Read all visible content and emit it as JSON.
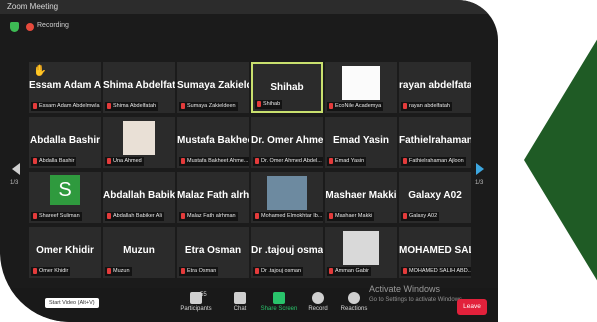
{
  "window": {
    "title": "Zoom Meeting",
    "recording_label": "Recording"
  },
  "pages": {
    "left": "1/3",
    "right": "1/3"
  },
  "tiles": [
    {
      "name": "Essam Adam Ab...",
      "label": "Essam Adam Abdelmwla",
      "hand": "✋"
    },
    {
      "name": "Shima Abdelfatah",
      "label": "Shima Abdelfatah"
    },
    {
      "name": "Sumaya Zakield...",
      "label": "Sumaya Zakieldeen"
    },
    {
      "name": "Shihab",
      "label": "Shihab"
    },
    {
      "name": "",
      "label": "EcoNile Academya"
    },
    {
      "name": "rayan abdelfatah",
      "label": "rayan abdelfatah"
    },
    {
      "name": "Abdalla Bashir",
      "label": "Abdalla Bashir"
    },
    {
      "name": "",
      "label": "Una Ahmed"
    },
    {
      "name": "Mustafa Bakhee...",
      "label": "Mustafa Bakheet Ahme..."
    },
    {
      "name": "Dr. Omer Ahme...",
      "label": "Dr. Omer Ahmed Abdel..."
    },
    {
      "name": "Emad Yasin",
      "label": "Emad Yasin"
    },
    {
      "name": "Fathielrahaman...",
      "label": "Fathielrahaman Ajloon"
    },
    {
      "name": "",
      "label": "Shareef Suliman",
      "avatar_letter": "S"
    },
    {
      "name": "Abdallah Babike...",
      "label": "Abdallah Babiker Ali"
    },
    {
      "name": "Malaz Fath alrh...",
      "label": "Malaz Fath alrhman"
    },
    {
      "name": "",
      "label": "Mohamed Elmokhtar Ib..."
    },
    {
      "name": "Mashaer Makki",
      "label": "Mashaer Makki"
    },
    {
      "name": "Galaxy A02",
      "label": "Galaxy A02"
    },
    {
      "name": "Omer Khidir",
      "label": "Omer Khidir"
    },
    {
      "name": "Muzun",
      "label": "Muzun"
    },
    {
      "name": "Etra Osman",
      "label": "Etra Osman"
    },
    {
      "name": "Dr .tajouj osman",
      "label": "Dr .tajouj osman"
    },
    {
      "name": "",
      "label": "Amman Gabir"
    },
    {
      "name": "MOHAMED SALI...",
      "label": "MOHAMED SALIH ABD..."
    }
  ],
  "toolbar": {
    "participants_count": "55",
    "participants": "Participants",
    "chat": "Chat",
    "share": "Share Screen",
    "record": "Record",
    "reactions": "Reactions",
    "leave": "Leave",
    "tooltip": "Start Video (Alt+V)"
  },
  "activation": {
    "title": "Activate Windows",
    "subtitle": "Go to Settings to activate Windows."
  },
  "colors": {
    "active_border": "#c9e06e",
    "share_green": "#29c46b",
    "leave_red": "#e2213b",
    "arrow_green": "#1f5b25"
  }
}
